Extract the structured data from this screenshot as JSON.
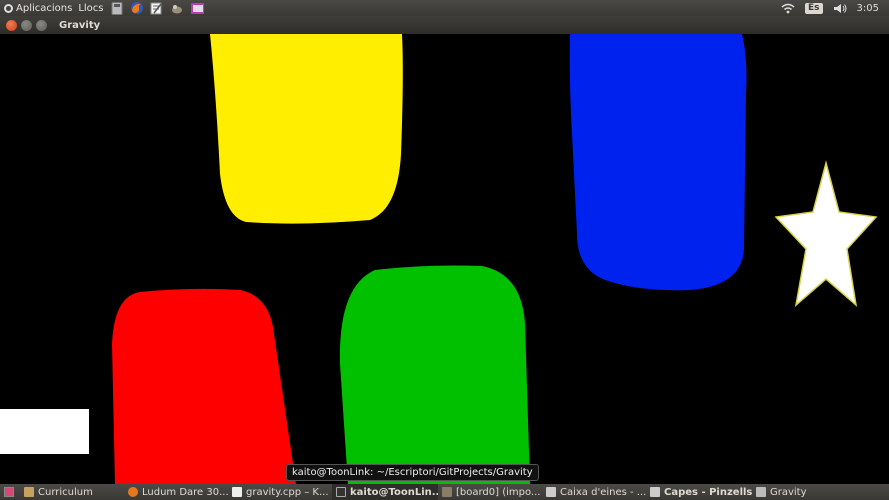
{
  "top_panel": {
    "menus": [
      "Aplicacions",
      "Llocs"
    ],
    "keyboard_layout": "Es",
    "clock": "3:05"
  },
  "window": {
    "title": "Gravity"
  },
  "tooltip": {
    "text": "kaito@ToonLink: ~/Escriptori/GitProjects/Gravity"
  },
  "taskbar": {
    "items": [
      {
        "label": "Curriculum",
        "icon": "folder-icon"
      },
      {
        "label": "Ludum Dare 30...",
        "icon": "firefox-icon"
      },
      {
        "label": "gravity.cpp – K...",
        "icon": "editor-icon"
      },
      {
        "label": "kaito@ToonLin...",
        "icon": "terminal-icon"
      },
      {
        "label": "[board0] (impo...",
        "icon": "gimp-icon"
      },
      {
        "label": "Caixa d'eines - ...",
        "icon": "gimp-toolbox-icon"
      },
      {
        "label": "Capes - Pinzells",
        "icon": "gimp-toolbox-icon"
      },
      {
        "label": "Gravity",
        "icon": "window-icon"
      }
    ]
  },
  "colors": {
    "yellow": "#ffee00",
    "blue": "#0022ee",
    "red": "#ff0000",
    "green": "#00c000",
    "white": "#ffffff",
    "star_outline": "#d8d24a"
  }
}
